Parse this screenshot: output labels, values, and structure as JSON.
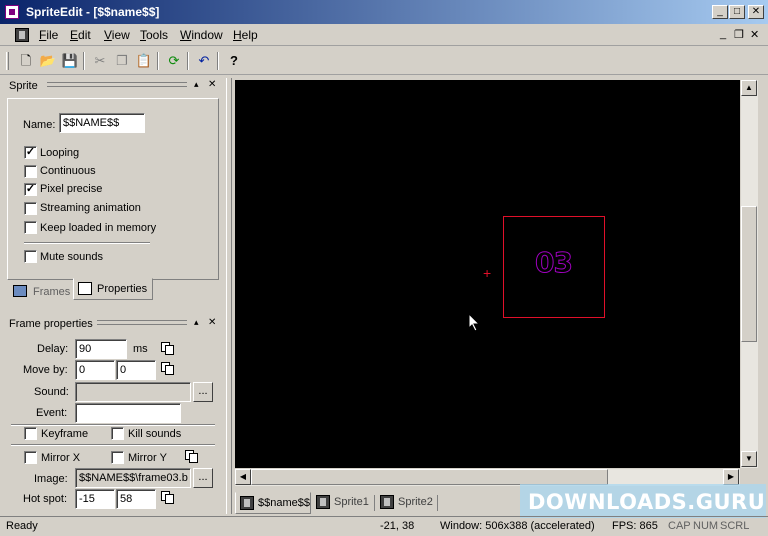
{
  "window": {
    "title": "SpriteEdit - [$$name$$]",
    "minimize": "_",
    "maximize": "□",
    "close": "✕"
  },
  "menu": {
    "items": [
      "File",
      "Edit",
      "View",
      "Tools",
      "Window",
      "Help"
    ],
    "mdi_minimize": "_",
    "mdi_restore": "❐",
    "mdi_close": "✕"
  },
  "toolbar": {
    "icons": [
      "new-icon",
      "open-icon",
      "save-icon",
      "cut-icon",
      "copy-icon",
      "paste-icon",
      "refresh-icon",
      "undo-icon",
      "help-icon"
    ]
  },
  "sprite_panel": {
    "title": "Sprite",
    "name_label": "Name:",
    "name_value": "$$NAME$$",
    "options": [
      {
        "label": "Looping",
        "checked": true
      },
      {
        "label": "Continuous",
        "checked": false
      },
      {
        "label": "Pixel precise",
        "checked": true
      },
      {
        "label": "Streaming animation",
        "checked": false
      },
      {
        "label": "Keep loaded in memory",
        "checked": false
      },
      {
        "label": "Mute sounds",
        "checked": false
      }
    ],
    "tabs": [
      "Frames",
      "Properties"
    ],
    "active_tab": "Properties",
    "pin": "▴",
    "close": "✕"
  },
  "frame_panel": {
    "title": "Frame properties",
    "pin": "▴",
    "close": "✕",
    "delay_label": "Delay:",
    "delay_value": "90",
    "delay_unit": "ms",
    "moveby_label": "Move by:",
    "moveby_x": "0",
    "moveby_y": "0",
    "sound_label": "Sound:",
    "sound_value": "",
    "browse": "...",
    "event_label": "Event:",
    "event_value": "",
    "keyframe_label": "Keyframe",
    "killsounds_label": "Kill sounds",
    "mirrorx_label": "Mirror X",
    "mirrory_label": "Mirror Y",
    "image_label": "Image:",
    "image_value": "$$NAME$$\\frame03.b",
    "hotspot_label": "Hot spot:",
    "hotspot_x": "-15",
    "hotspot_y": "58"
  },
  "canvas": {
    "frame_text": "03",
    "hotspot_marker": "+",
    "frame_color": "#e0102a",
    "text_color": "#a000c0"
  },
  "document_tabs": [
    "$$name$$",
    "Sprite1",
    "Sprite2"
  ],
  "active_document": "$$name$$",
  "watermark": "DOWNLOADS.GURU",
  "status": {
    "ready": "Ready",
    "coords": "-21, 38",
    "window": "Window: 506x388 (accelerated)",
    "fps": "FPS: 865",
    "cap": "CAP",
    "num": "NUM",
    "scrl": "SCRL"
  }
}
